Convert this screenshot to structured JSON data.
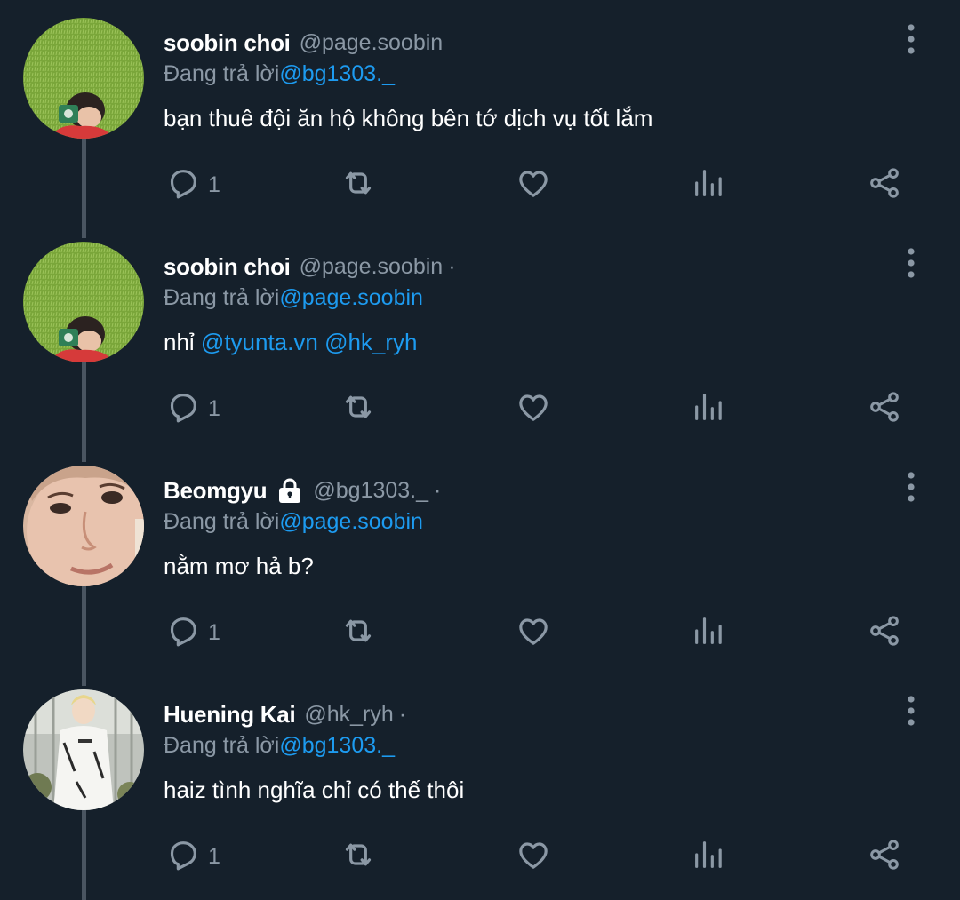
{
  "theme": {
    "background": "#15202b",
    "text_primary": "#ffffff",
    "text_secondary": "#8b98a5",
    "link": "#1d9bf0",
    "icon": "#8b98a5",
    "thread_line": "#4a5561"
  },
  "tweets": [
    {
      "name": "soobin choi",
      "handle": "@page.soobin",
      "separator": "",
      "locked": false,
      "reply_prefix": "Đang trả lời ",
      "reply_to": "@bg1303._",
      "body": [
        {
          "text": "bạn thuê đội ăn hộ không bên tớ dịch vụ tốt lắm",
          "type": "text"
        }
      ],
      "reply_count": "1",
      "avatar": "boy-with-camera-on-grass"
    },
    {
      "name": "soobin choi",
      "handle": "@page.soobin",
      "separator": "·",
      "locked": false,
      "reply_prefix": "Đang trả lời ",
      "reply_to": "@page.soobin",
      "body": [
        {
          "text": "nhỉ ",
          "type": "text"
        },
        {
          "text": "@tyunta.vn",
          "type": "mention"
        },
        {
          "text": " ",
          "type": "text"
        },
        {
          "text": "@hk_ryh",
          "type": "mention"
        }
      ],
      "reply_count": "1",
      "avatar": "boy-with-camera-on-grass"
    },
    {
      "name": "Beomgyu",
      "handle": "@bg1303._",
      "separator": "·",
      "locked": true,
      "reply_prefix": "Đang trả lời ",
      "reply_to": "@page.soobin",
      "body": [
        {
          "text": "nằm mơ hả b?",
          "type": "text"
        }
      ],
      "reply_count": "1",
      "avatar": "close-up-face"
    },
    {
      "name": "Huening Kai",
      "handle": "@hk_ryh",
      "separator": "·",
      "locked": false,
      "reply_prefix": "Đang trả lời ",
      "reply_to": "@bg1303._",
      "body": [
        {
          "text": "haiz tình nghĩa chỉ có thế thôi",
          "type": "text"
        }
      ],
      "reply_count": "1",
      "avatar": "person-in-white-shirt"
    }
  ],
  "icons": {
    "reply": "reply-bubble-icon",
    "retweet": "retweet-icon",
    "like": "heart-icon",
    "views": "views-bar-icon",
    "share": "share-icon",
    "more": "more-vertical-icon",
    "lock": "lock-icon"
  }
}
